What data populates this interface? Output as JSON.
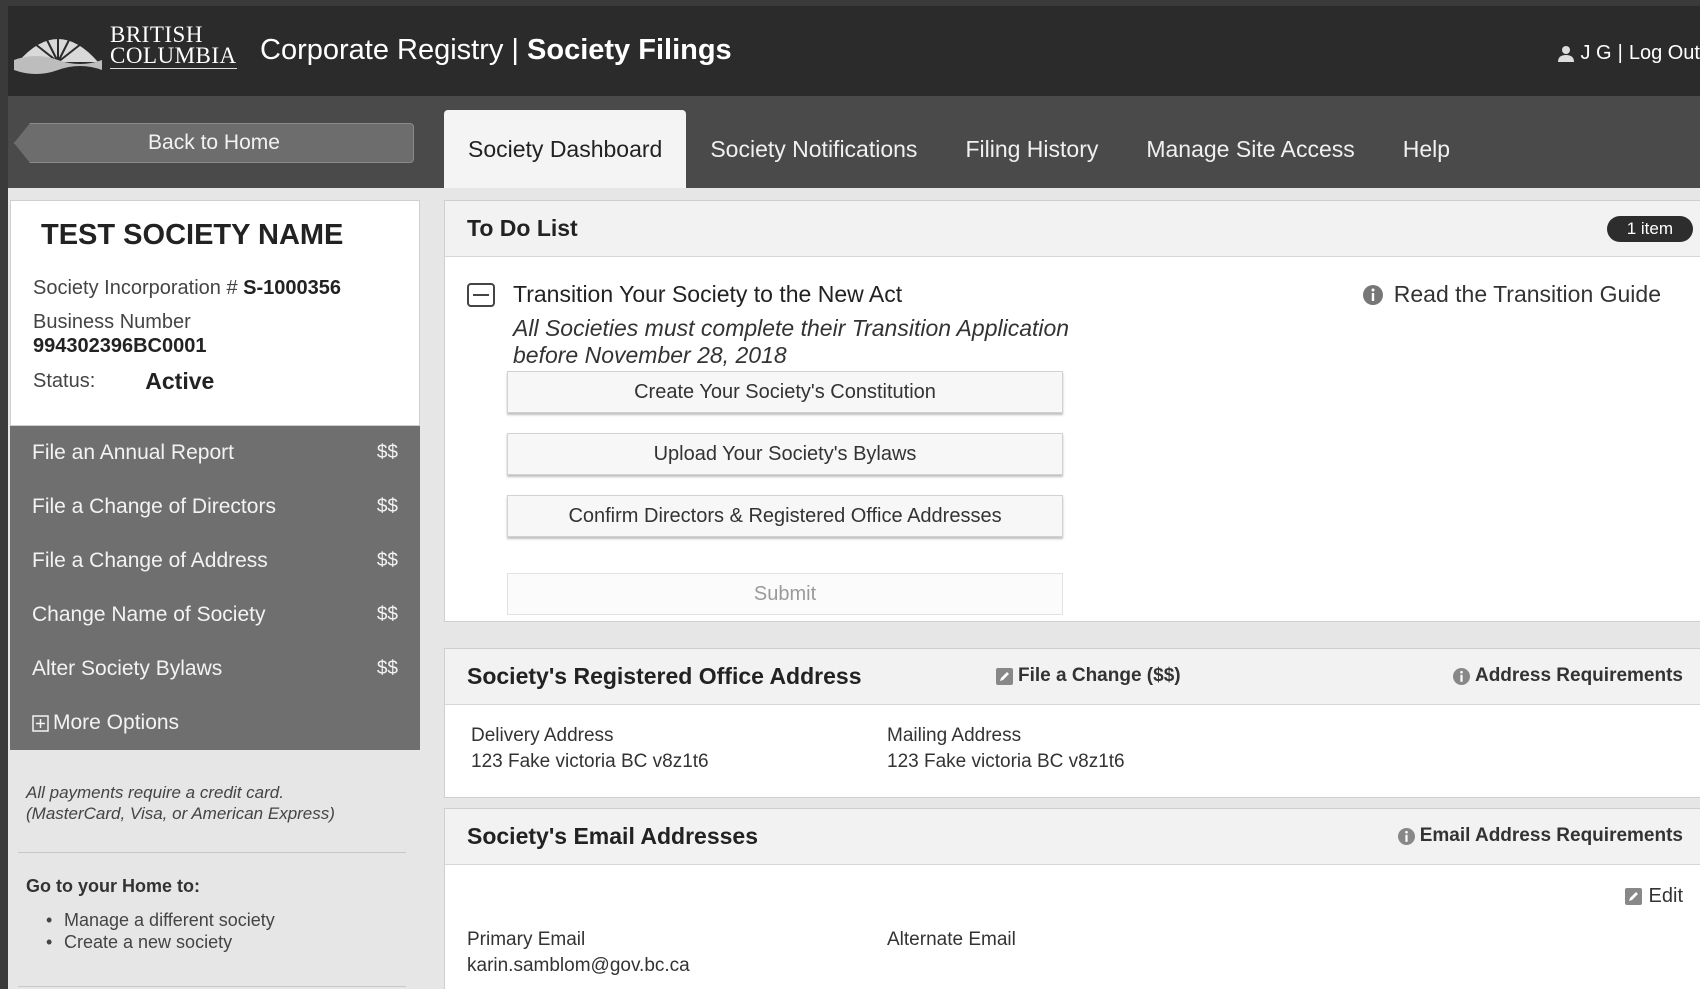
{
  "header": {
    "logo_line1": "BRITISH",
    "logo_line2": "COLUMBIA",
    "title_part1": "Corporate Registry | ",
    "title_part2": "Society Filings",
    "user_initials": "J G",
    "separator": "|",
    "logout_label": "Log Out"
  },
  "nav": {
    "back_label": "Back to Home",
    "tabs": [
      {
        "label": "Society Dashboard",
        "active": true
      },
      {
        "label": "Society Notifications",
        "active": false
      },
      {
        "label": "Filing History",
        "active": false
      },
      {
        "label": "Manage Site Access",
        "active": false
      },
      {
        "label": "Help",
        "active": false
      }
    ]
  },
  "society": {
    "name": "TEST SOCIETY NAME",
    "incorporation_label": "Society Incorporation # ",
    "incorporation_number": "S-1000356",
    "business_number_label": "Business Number",
    "business_number": "994302396BC0001",
    "status_label": "Status:",
    "status": "Active"
  },
  "sidebar": {
    "actions": [
      {
        "label": "File an Annual Report",
        "price": "$$"
      },
      {
        "label": "File a Change of Directors",
        "price": "$$"
      },
      {
        "label": "File a Change of Address",
        "price": "$$"
      },
      {
        "label": "Change Name of Society",
        "price": "$$"
      },
      {
        "label": "Alter Society Bylaws",
        "price": "$$"
      }
    ],
    "more_options": "More Options",
    "payment_note_line1": "All payments require a credit card.",
    "payment_note_line2": "(MasterCard, Visa, or American Express)",
    "home_title": "Go to your Home to:",
    "home_items": [
      "Manage a different society",
      "Create a new society"
    ]
  },
  "todo": {
    "title": "To Do List",
    "badge": "1 item",
    "item_title": "Transition Your Society to the New Act",
    "item_desc_line1": "All Societies must complete their Transition Application",
    "item_desc_line2": "before November 28, 2018",
    "guide_link": "Read the Transition Guide",
    "buttons": [
      "Create Your Society's Constitution",
      "Upload Your Society's Bylaws",
      "Confirm Directors & Registered Office Addresses"
    ],
    "submit_label": "Submit"
  },
  "office": {
    "title": "Society's Registered Office Address",
    "file_change_label": "File a Change ($$)",
    "requirements_label": "Address Requirements",
    "delivery_label": "Delivery Address",
    "delivery_value": "123 Fake victoria BC v8z1t6",
    "mailing_label": "Mailing Address",
    "mailing_value": "123 Fake victoria BC v8z1t6"
  },
  "email": {
    "title": "Society's Email Addresses",
    "requirements_label": "Email Address Requirements",
    "edit_label": "Edit",
    "primary_label": "Primary Email",
    "primary_value": "karin.samblom@gov.bc.ca",
    "alternate_label": "Alternate Email"
  }
}
